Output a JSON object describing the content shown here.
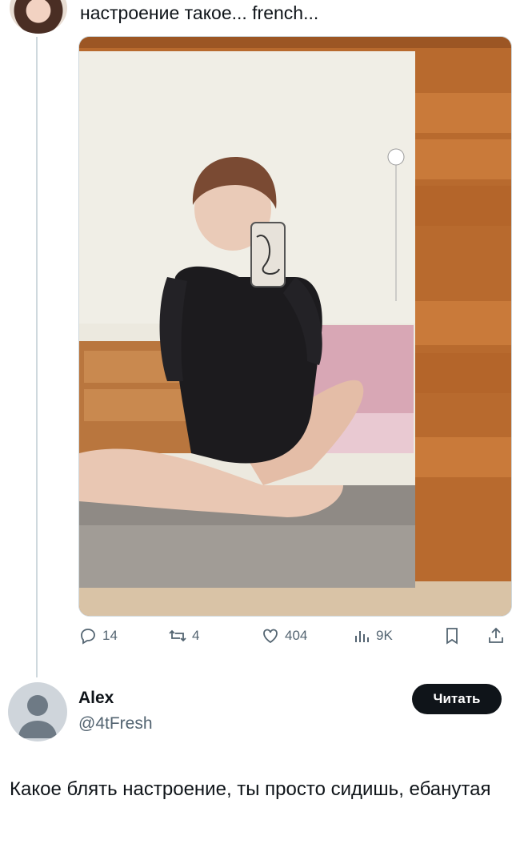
{
  "tweet": {
    "text": "настроение такое... french..."
  },
  "actions": {
    "replies": "14",
    "retweets": "4",
    "likes": "404",
    "views": "9K"
  },
  "reply": {
    "author_name": "Alex",
    "author_handle": "@4tFresh",
    "follow_label": "Читать",
    "text": "Какое блять настроение, ты просто сидишь, ебанутая"
  }
}
